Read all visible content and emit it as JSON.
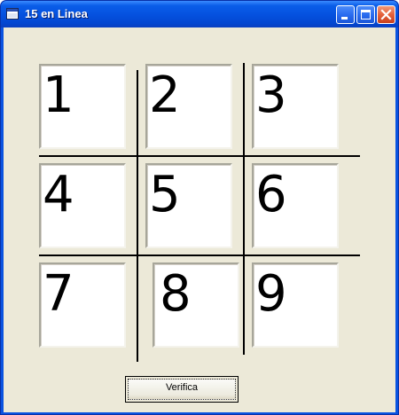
{
  "window": {
    "title": "15 en Linea",
    "icon": "app-window-icon",
    "controls": {
      "minimize_icon": "minimize-icon",
      "maximize_icon": "maximize-icon",
      "close_icon": "close-icon"
    },
    "accent_color": "#0a53e0"
  },
  "grid": {
    "tiles": [
      "1",
      "2",
      "3",
      "4",
      "5",
      "6",
      "7",
      "8",
      "9"
    ]
  },
  "verify_button": {
    "label": "Verifica"
  }
}
